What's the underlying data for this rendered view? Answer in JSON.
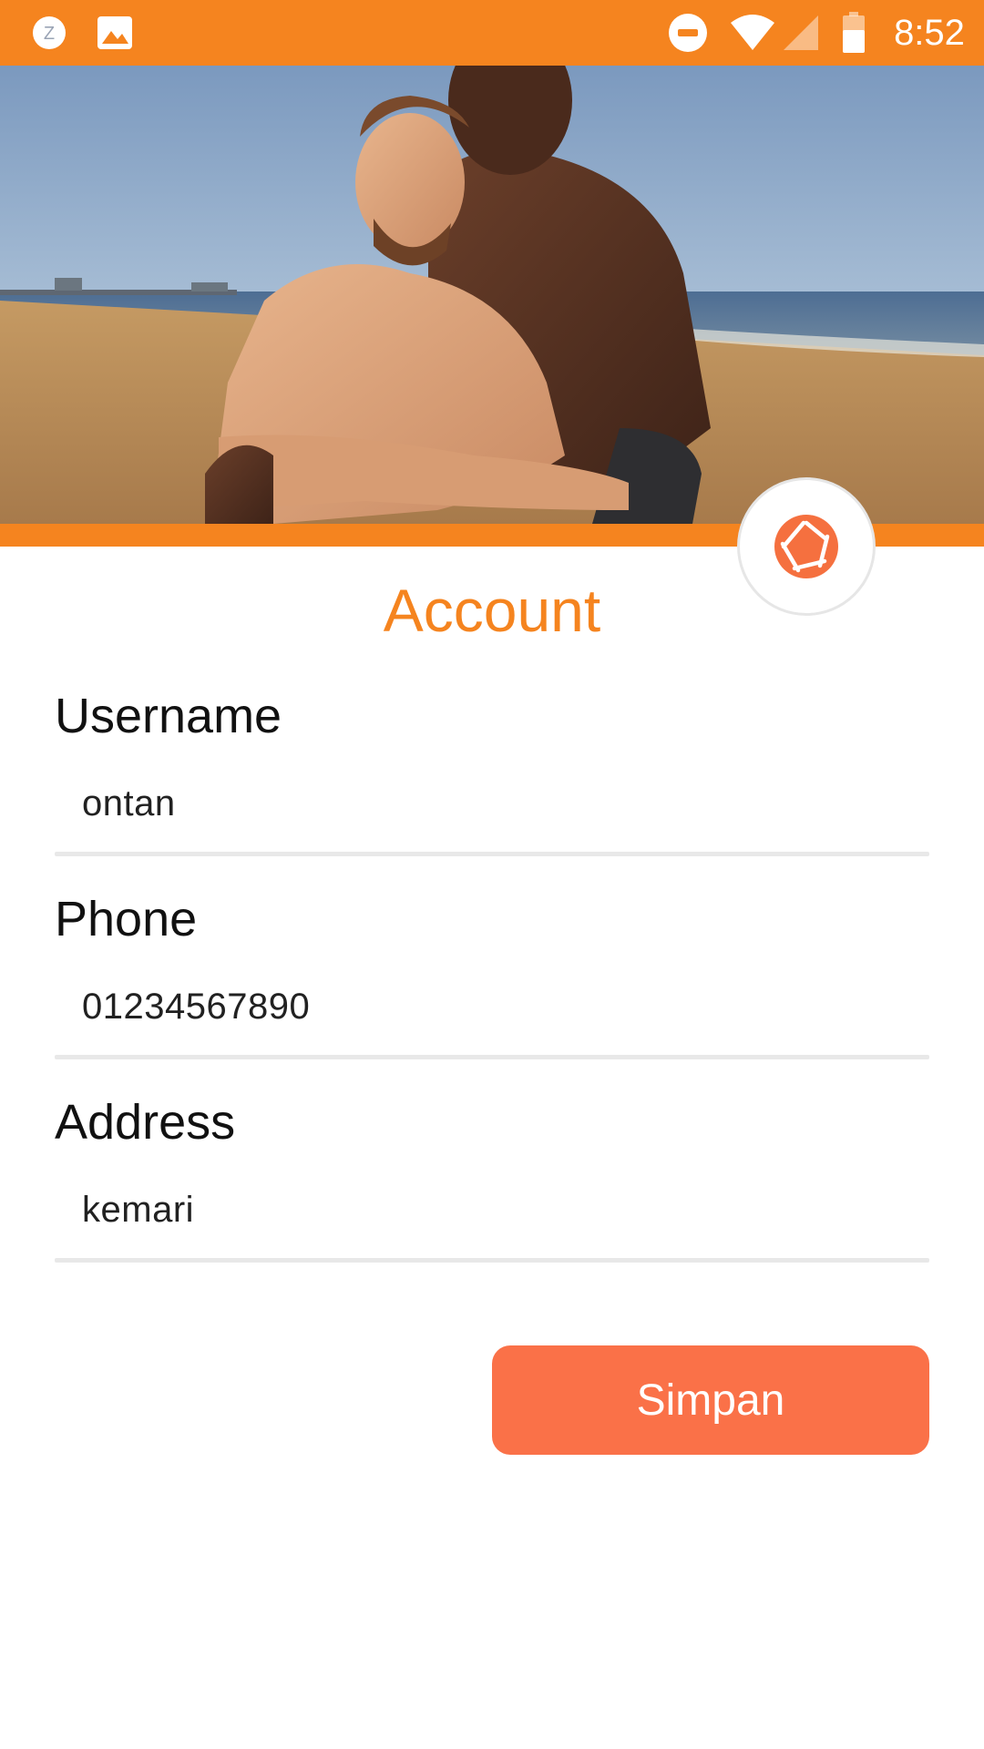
{
  "status_bar": {
    "time": "8:52",
    "left_icons": [
      "z-app-icon",
      "gallery-icon"
    ],
    "right_icons": [
      "do-not-disturb-icon",
      "wifi-icon",
      "cell-signal-icon",
      "battery-icon"
    ],
    "color": "#F5841F"
  },
  "cover": {
    "image": "beach-couple-photo"
  },
  "camera_button": {
    "icon": "camera-aperture-icon",
    "icon_color": "#F5703F"
  },
  "page": {
    "title": "Account",
    "accent_color": "#F5841F"
  },
  "form": {
    "username": {
      "label": "Username",
      "value": "ontan"
    },
    "phone": {
      "label": "Phone",
      "value": "01234567890"
    },
    "address": {
      "label": "Address",
      "value": "kemari"
    }
  },
  "actions": {
    "save_label": "Simpan",
    "save_color": "#FA7148"
  }
}
